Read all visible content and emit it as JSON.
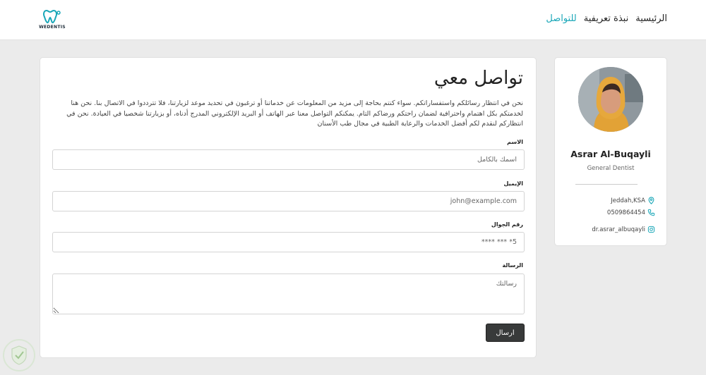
{
  "brand": {
    "logo_text": "WEDENTIS"
  },
  "nav": {
    "items": [
      {
        "label": "الرئيسية"
      },
      {
        "label": "نبذة تعريفية"
      },
      {
        "label": "للتواصل"
      }
    ]
  },
  "contact": {
    "title": "تواصل معي",
    "description": "نحن في انتظار رسائلكم واستفساراتكم. سواء كنتم بحاجة إلى مزيد من المعلومات عن خدماتنا أو ترغبون في تحديد موعد لزيارتنا، فلا تترددوا في الاتصال بنا. نحن هنا لخدمتكم بكل اهتمام واحترافية لضمان راحتكم ورضاكم التام. يمكنكم التواصل معنا عبر الهاتف أو البريد الإلكتروني المدرج أدناه، أو بزيارتنا شخصيا في العيادة. نحن في انتظاركم لنقدم لكم أفضل الخدمات والرعاية الطبية في مجال طب الأسنان",
    "name_label": "الاسم",
    "name_placeholder": "اسمك بالكامل",
    "email_label": "الإيميل",
    "email_placeholder": "john@example.com",
    "phone_label": "رقم الجوال",
    "phone_placeholder": "5* *** ****",
    "message_label": "الرسالة",
    "message_placeholder": "رسالتك",
    "send_label": "ارسال"
  },
  "profile": {
    "name": "Asrar Al-Buqayli",
    "title": "General Dentist",
    "location": "Jeddah,KSA",
    "phone": "0509864454",
    "instagram": "dr.asrar_albuqayli"
  },
  "colors": {
    "accent": "#1aa7b8",
    "button": "#383a3a",
    "background": "#ebebeb"
  }
}
